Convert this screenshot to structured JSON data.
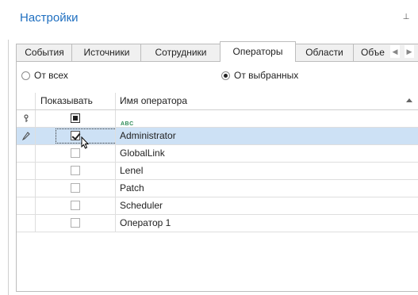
{
  "panel": {
    "title": "Настройки",
    "pin_icon": "pin-icon"
  },
  "tabs": [
    {
      "label": "События",
      "active": false
    },
    {
      "label": "Источники",
      "active": false
    },
    {
      "label": "Сотрудники",
      "active": false
    },
    {
      "label": "Операторы",
      "active": true
    },
    {
      "label": "Области",
      "active": false
    },
    {
      "label": "Объе",
      "active": false
    }
  ],
  "tab_nav": {
    "prev_icon": "chevron-left-icon",
    "next_icon": "chevron-right-icon"
  },
  "filter_mode": {
    "options": [
      {
        "label": "От всех",
        "checked": false
      },
      {
        "label": "От выбранных",
        "checked": true
      }
    ]
  },
  "grid": {
    "columns": {
      "show": "Показывать",
      "name": "Имя оператора"
    },
    "filter_row": {
      "show_state": "indeterminate",
      "name_filter_icon": "text-filter-icon",
      "name_filter_glyph": "ABC"
    },
    "rows": [
      {
        "name": "Administrator",
        "checked": true,
        "selected": true,
        "indicator": "edit-pencil-icon"
      },
      {
        "name": "GlobalLink",
        "checked": false,
        "selected": false
      },
      {
        "name": "Lenel",
        "checked": false,
        "selected": false
      },
      {
        "name": "Patch",
        "checked": false,
        "selected": false
      },
      {
        "name": "Scheduler",
        "checked": false,
        "selected": false
      },
      {
        "name": "Оператор 1",
        "checked": false,
        "selected": false
      }
    ]
  },
  "colors": {
    "title": "#1f6fc0",
    "selection": "#cde1f5",
    "border": "#bcbcbc"
  }
}
